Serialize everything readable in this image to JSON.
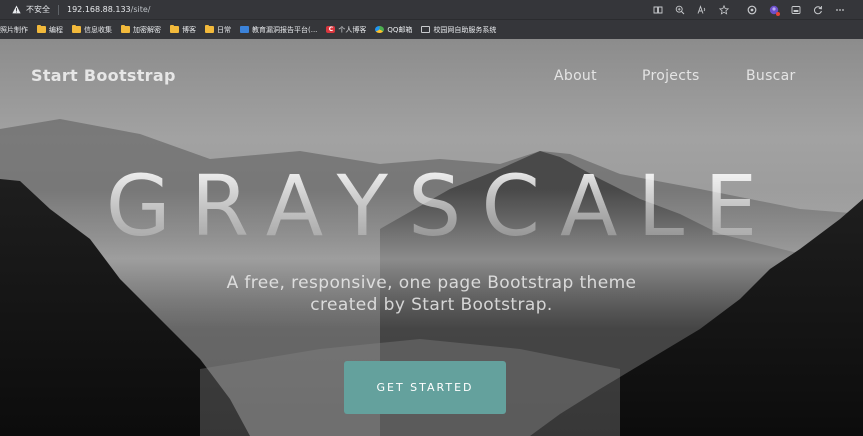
{
  "browser": {
    "security_label": "不安全",
    "url_host": "192.168.88.133",
    "url_path": "/site/",
    "toolbar_icons": [
      "reading-mode-icon",
      "zoom-icon",
      "read-aloud-icon",
      "favorite-star-icon",
      "extensions-icon",
      "collections-icon",
      "sidebar-icon",
      "refresh-icon",
      "more-icon"
    ]
  },
  "bookmarks": [
    {
      "label": "照片制作",
      "icon": "none"
    },
    {
      "label": "编程",
      "icon": "folder-icon"
    },
    {
      "label": "信息收集",
      "icon": "folder-icon"
    },
    {
      "label": "加密解密",
      "icon": "folder-icon"
    },
    {
      "label": "博客",
      "icon": "folder-icon"
    },
    {
      "label": "日常",
      "icon": "folder-icon"
    },
    {
      "label": "教育漏洞报告平台(...",
      "icon": "site-icon"
    },
    {
      "label": "个人博客",
      "icon": "c-site-icon"
    },
    {
      "label": "QQ邮箱",
      "icon": "qq-icon"
    },
    {
      "label": "校园网自助服务系统",
      "icon": "page-icon"
    }
  ],
  "page": {
    "brand": "Start Bootstrap",
    "nav": [
      "About",
      "Projects",
      "Buscar"
    ],
    "headline": "GRAYSCALE",
    "tagline_line1": "A free, responsive, one page Bootstrap theme",
    "tagline_line2": "created by Start Bootstrap.",
    "cta_label": "GET STARTED",
    "accent_color": "#64a19d"
  }
}
